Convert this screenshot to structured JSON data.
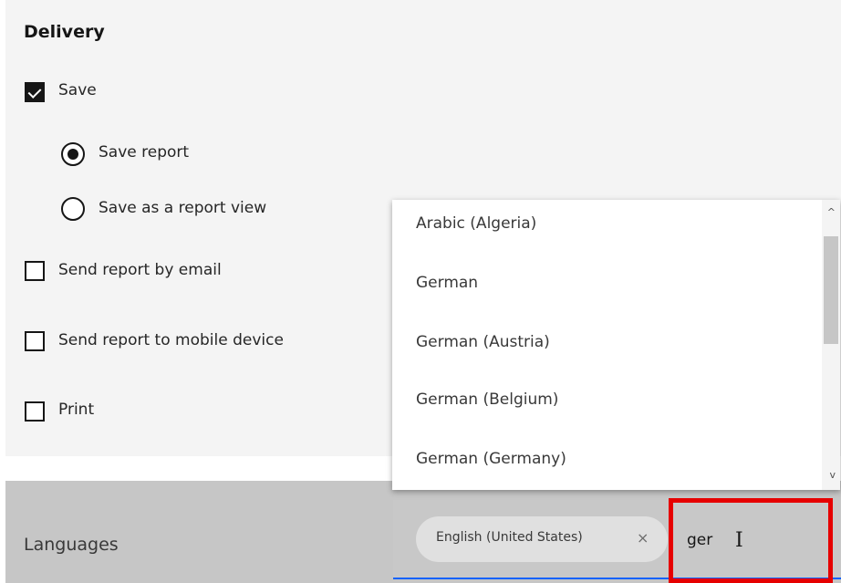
{
  "delivery": {
    "title": "Delivery",
    "save": {
      "label": "Save",
      "checked": true
    },
    "save_options": [
      {
        "label": "Save report",
        "selected": true
      },
      {
        "label": "Save as a report view",
        "selected": false
      }
    ],
    "send_email": {
      "label": "Send report by email",
      "checked": false
    },
    "send_mobile": {
      "label": "Send report to mobile device",
      "checked": false
    },
    "print": {
      "label": "Print",
      "checked": false
    }
  },
  "languages": {
    "label": "Languages",
    "selected_tag": "English (United States)",
    "tag_close_icon": "×",
    "input_value": "ger",
    "dropdown_options": [
      "Arabic (Algeria)",
      "German",
      "German (Austria)",
      "German (Belgium)",
      "German (Germany)"
    ],
    "scroll_up_icon": "^",
    "scroll_down_icon": "v"
  },
  "colors": {
    "highlight": "#e60000",
    "focus_underline": "#0f62fe",
    "panel_bg": "#f4f4f4",
    "languages_bg": "#c6c6c6"
  }
}
